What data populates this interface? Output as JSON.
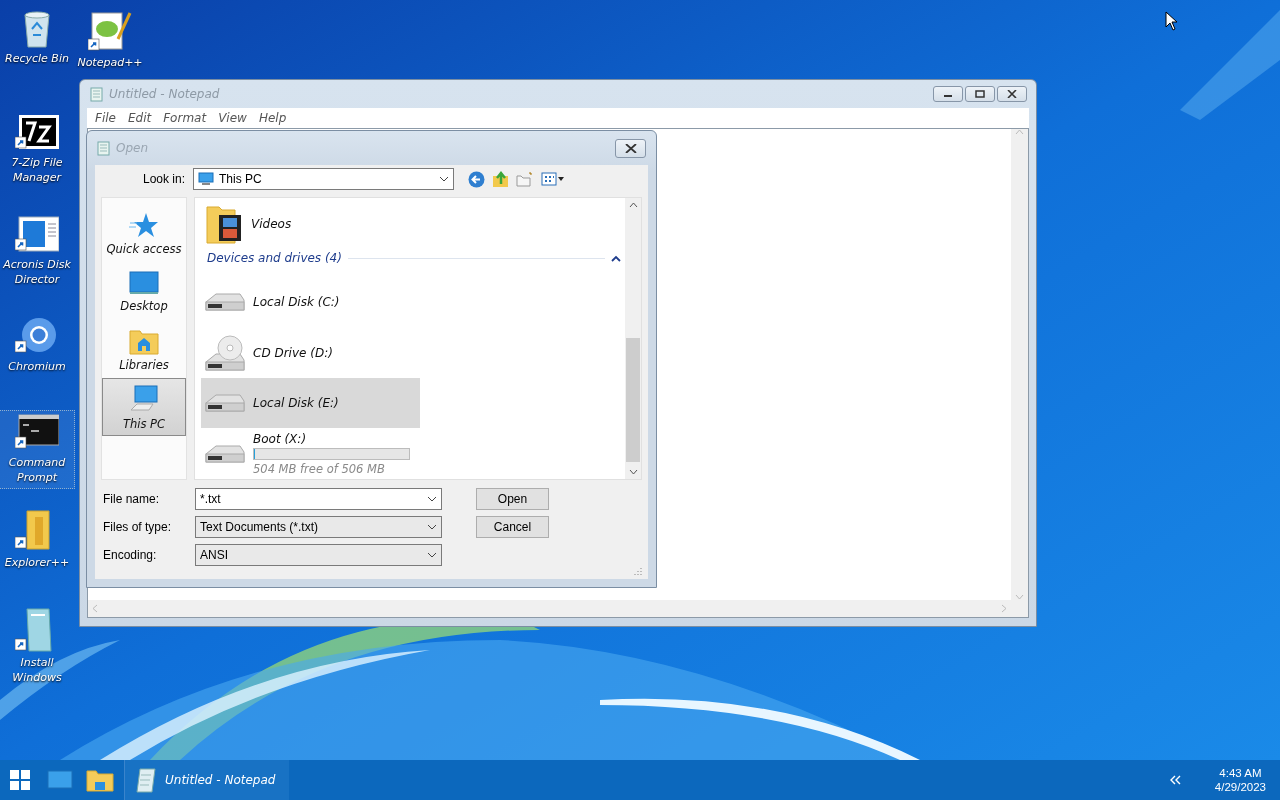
{
  "desktop_icons": [
    {
      "label": "Recycle Bin",
      "selected": false
    },
    {
      "label": "Notepad++",
      "selected": false
    },
    {
      "label": "7-Zip File Manager",
      "selected": false
    },
    {
      "label": "Acronis Disk Director",
      "selected": false
    },
    {
      "label": "Chromium",
      "selected": false
    },
    {
      "label": "Command Prompt",
      "selected": true
    },
    {
      "label": "Explorer++",
      "selected": false
    },
    {
      "label": "Install Windows",
      "selected": false
    }
  ],
  "notepad": {
    "title": "Untitled - Notepad",
    "menu": [
      "File",
      "Edit",
      "Format",
      "View",
      "Help"
    ]
  },
  "open_dialog": {
    "title": "Open",
    "look_in": {
      "label": "Look in:",
      "value": "This PC"
    },
    "places": [
      {
        "label": "Quick access",
        "selected": false
      },
      {
        "label": "Desktop",
        "selected": false
      },
      {
        "label": "Libraries",
        "selected": false
      },
      {
        "label": "This PC",
        "selected": true
      }
    ],
    "folders": [
      {
        "name": "Videos"
      }
    ],
    "group": {
      "label": "Devices and drives (4)",
      "expanded": true
    },
    "drives": [
      {
        "kind": "disk",
        "name": "Local Disk (C:)",
        "selected": false
      },
      {
        "kind": "cd",
        "name": "CD Drive (D:)",
        "selected": false
      },
      {
        "kind": "disk",
        "name": "Local Disk (E:)",
        "selected": true
      },
      {
        "kind": "disk",
        "name": "Boot (X:)",
        "selected": false,
        "level": 0.004,
        "free": "504 MB free of 506 MB"
      }
    ],
    "file_name": {
      "label": "File name:",
      "value": "*.txt"
    },
    "files_of_type": {
      "label": "Files of type:",
      "value": "Text Documents (*.txt)"
    },
    "encoding": {
      "label": "Encoding:",
      "value": "ANSI"
    },
    "buttons": [
      "Open",
      "Cancel"
    ]
  },
  "taskbar": {
    "tasks": [
      {
        "label": "Untitled - Notepad",
        "selected": true
      }
    ],
    "time": "4:43 AM",
    "date": "4/29/2023"
  }
}
